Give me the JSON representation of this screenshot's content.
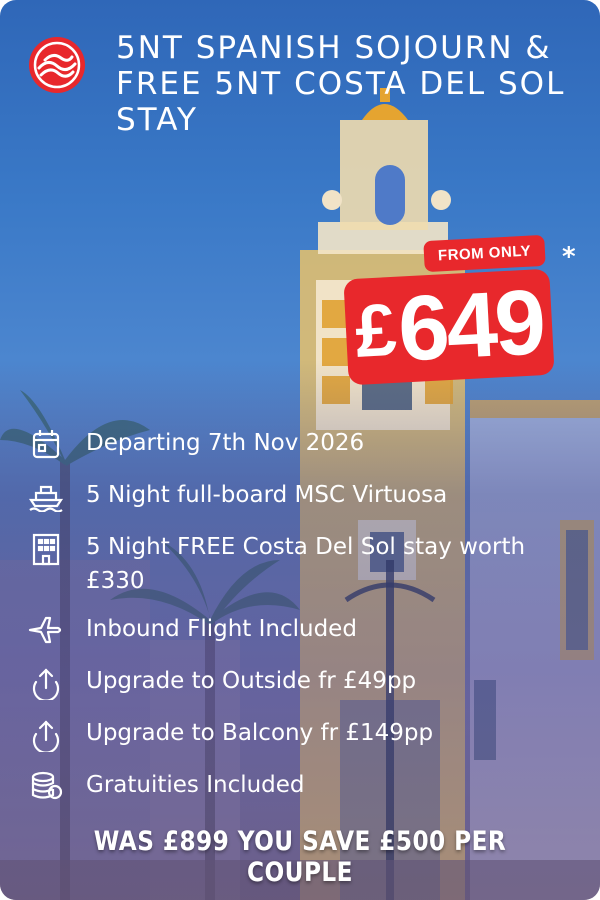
{
  "title": "5NT SPANISH SOJOURN & FREE 5NT COSTA DEL SOL STAY",
  "price": {
    "from_label": "FROM ONLY",
    "currency": "£",
    "amount": "649",
    "asterisk": "*"
  },
  "features": [
    {
      "icon": "calendar-icon",
      "text": "Departing 7th Nov 2026"
    },
    {
      "icon": "ship-icon",
      "text": "5 Night full-board MSC Virtuosa"
    },
    {
      "icon": "hotel-icon",
      "text": "5 Night FREE Costa Del Sol stay worth £330"
    },
    {
      "icon": "plane-icon",
      "text": "Inbound Flight Included"
    },
    {
      "icon": "upgrade-icon",
      "text": "Upgrade to Outside fr £49pp"
    },
    {
      "icon": "upgrade-icon",
      "text": "Upgrade to Balcony fr £149pp"
    },
    {
      "icon": "coins-icon",
      "text": "Gratuities Included"
    }
  ],
  "savings": "WAS £899 YOU SAVE £500 PER COUPLE",
  "colors": {
    "accent": "#e8282c",
    "text": "#ffffff"
  }
}
